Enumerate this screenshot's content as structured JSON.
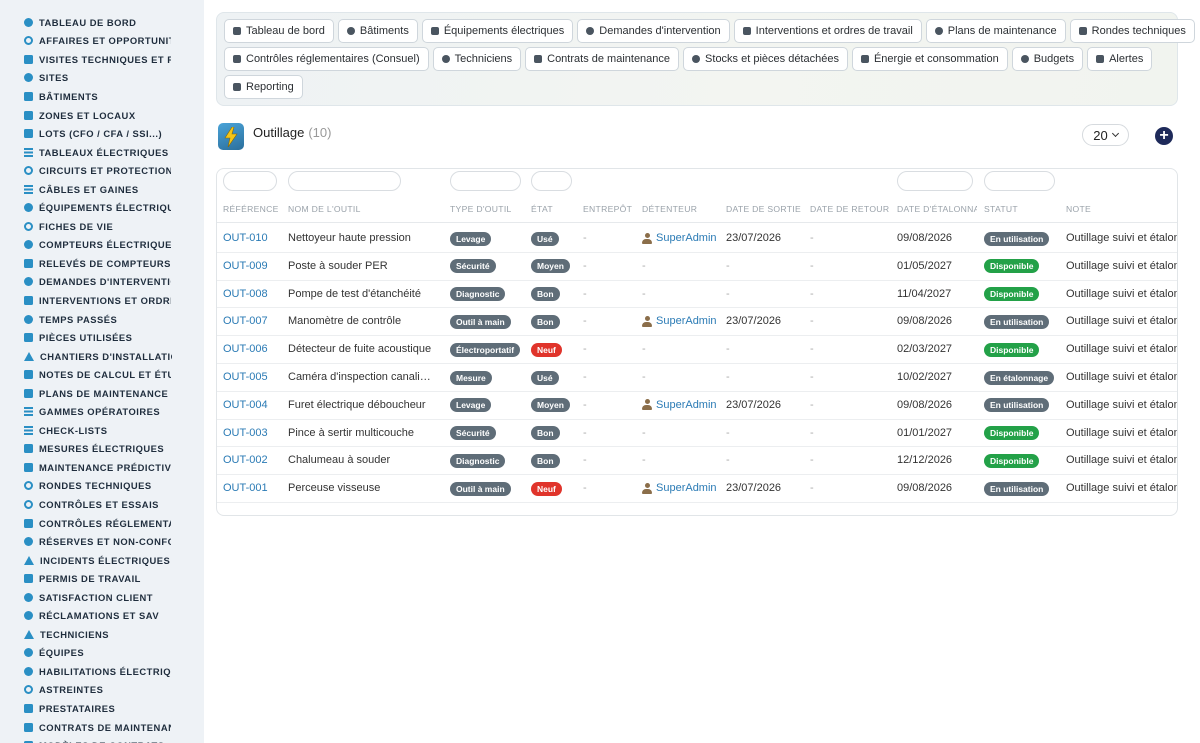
{
  "sidebar": {
    "items": [
      {
        "label": "TABLEAU DE BORD",
        "icon": "dashboard-icon",
        "shape": "circle"
      },
      {
        "label": "AFFAIRES ET OPPORTUNITÉS",
        "icon": "target-icon",
        "shape": "ring"
      },
      {
        "label": "VISITES TECHNIQUES ET RELEVÉS",
        "icon": "walk-icon",
        "shape": "square"
      },
      {
        "label": "SITES",
        "icon": "map-pin-icon",
        "shape": "circle"
      },
      {
        "label": "BÂTIMENTS",
        "icon": "building-icon",
        "shape": "square"
      },
      {
        "label": "ZONES ET LOCAUX",
        "icon": "door-icon",
        "shape": "square"
      },
      {
        "label": "LOTS (CFO / CFA / SSI...)",
        "icon": "sitemap-icon",
        "shape": "square"
      },
      {
        "label": "TABLEAUX ÉLECTRIQUES",
        "icon": "table-icon",
        "shape": "bars"
      },
      {
        "label": "CIRCUITS ET PROTECTIONS",
        "icon": "circuit-icon",
        "shape": "ring"
      },
      {
        "label": "CÂBLES ET GAINES",
        "icon": "cable-icon",
        "shape": "bars"
      },
      {
        "label": "ÉQUIPEMENTS ÉLECTRIQUES",
        "icon": "cogs-icon",
        "shape": "circle"
      },
      {
        "label": "FICHES DE VIE",
        "icon": "history-icon",
        "shape": "ring"
      },
      {
        "label": "COMPTEURS ÉLECTRIQUES",
        "icon": "gauge-icon",
        "shape": "circle"
      },
      {
        "label": "RELEVÉS DE COMPTEURS",
        "icon": "clipboard-icon",
        "shape": "square"
      },
      {
        "label": "DEMANDES D'INTERVENTION",
        "icon": "question-icon",
        "shape": "circle"
      },
      {
        "label": "INTERVENTIONS ET ORDRES DE TRAVAIL",
        "icon": "clipboard-check-icon",
        "shape": "square"
      },
      {
        "label": "TEMPS PASSÉS",
        "icon": "clock-icon",
        "shape": "circle"
      },
      {
        "label": "PIÈCES UTILISÉES",
        "icon": "cubes-icon",
        "shape": "square"
      },
      {
        "label": "CHANTIERS D'INSTALLATION",
        "icon": "hammer-icon",
        "shape": "tri"
      },
      {
        "label": "NOTES DE CALCUL ET ÉTUDES",
        "icon": "calculator-icon",
        "shape": "square"
      },
      {
        "label": "PLANS DE MAINTENANCE",
        "icon": "calendar-icon",
        "shape": "square"
      },
      {
        "label": "GAMMES OPÉRATOIRES",
        "icon": "list-icon",
        "shape": "bars"
      },
      {
        "label": "CHECK-LISTS",
        "icon": "checklist-icon",
        "shape": "bars"
      },
      {
        "label": "MESURES ÉLECTRIQUES",
        "icon": "ruler-icon",
        "shape": "square"
      },
      {
        "label": "MAINTENANCE PRÉDICTIVE",
        "icon": "chart-line-icon",
        "shape": "square"
      },
      {
        "label": "RONDES TECHNIQUES",
        "icon": "route-icon",
        "shape": "ring"
      },
      {
        "label": "CONTRÔLES ET ESSAIS",
        "icon": "search-icon",
        "shape": "ring"
      },
      {
        "label": "CONTRÔLES RÉGLEMENTAIRES (CONSUEL)",
        "icon": "clipboard-check-icon",
        "shape": "square"
      },
      {
        "label": "RÉSERVES ET NON-CONFORMITÉS",
        "icon": "exclamation-icon",
        "shape": "circle"
      },
      {
        "label": "INCIDENTS ÉLECTRIQUES",
        "icon": "warning-icon",
        "shape": "tri"
      },
      {
        "label": "PERMIS DE TRAVAIL",
        "icon": "file-signature-icon",
        "shape": "square"
      },
      {
        "label": "SATISFACTION CLIENT",
        "icon": "smile-icon",
        "shape": "circle"
      },
      {
        "label": "RÉCLAMATIONS ET SAV",
        "icon": "comment-icon",
        "shape": "circle"
      },
      {
        "label": "TECHNICIENS",
        "icon": "hard-hat-icon",
        "shape": "tri"
      },
      {
        "label": "ÉQUIPES",
        "icon": "users-icon",
        "shape": "circle"
      },
      {
        "label": "HABILITATIONS ÉLECTRIQUES",
        "icon": "certificate-icon",
        "shape": "circle"
      },
      {
        "label": "ASTREINTES",
        "icon": "phone-icon",
        "shape": "ring"
      },
      {
        "label": "PRESTATAIRES",
        "icon": "handshake-icon",
        "shape": "square"
      },
      {
        "label": "CONTRATS DE MAINTENANCE",
        "icon": "file-contract-icon",
        "shape": "square"
      },
      {
        "label": "MODÈLES DE CONTRATS",
        "icon": "file-icon",
        "shape": "square"
      }
    ]
  },
  "topnav": {
    "rows": [
      [
        {
          "label": "Tableau de bord",
          "icon": "dashboard-icon"
        },
        {
          "label": "Bâtiments",
          "icon": "building-icon"
        },
        {
          "label": "Équipements électriques",
          "icon": "cogs-icon"
        },
        {
          "label": "Demandes d'intervention",
          "icon": "question-icon"
        },
        {
          "label": "Interventions et ordres de travail",
          "icon": "clipboard-check-icon"
        },
        {
          "label": "Plans de maintenance",
          "icon": "calendar-icon"
        },
        {
          "label": "Rondes techniques",
          "icon": "route-icon"
        }
      ],
      [
        {
          "label": "Contrôles réglementaires (Consuel)",
          "icon": "clipboard-check-icon"
        },
        {
          "label": "Techniciens",
          "icon": "hard-hat-icon"
        },
        {
          "label": "Contrats de maintenance",
          "icon": "file-contract-icon"
        },
        {
          "label": "Stocks et pièces détachées",
          "icon": "sitemap-icon"
        },
        {
          "label": "Énergie et consommation",
          "icon": "bolt-icon"
        },
        {
          "label": "Budgets",
          "icon": "money-icon"
        },
        {
          "label": "Alertes",
          "icon": "bell-icon"
        }
      ],
      [
        {
          "label": "Reporting",
          "icon": "chart-pie-icon"
        }
      ]
    ]
  },
  "page": {
    "icon": "bolt-app-icon",
    "title": "Outillage",
    "count": "(10)",
    "per_page": "20",
    "add_icon": "plus-circle-icon"
  },
  "table": {
    "columns": [
      "RÉFÉRENCE",
      "NOM DE L'OUTIL",
      "TYPE D'OUTIL",
      "ÉTAT",
      "ENTREPÔT",
      "DÉTENTEUR",
      "DATE DE SORTIE",
      "DATE DE RETOUR",
      "DATE D'ÉTALONNAGE",
      "STATUT",
      "NOTE"
    ],
    "rows": [
      {
        "ref": "OUT-010",
        "name": "Nettoyeur haute pression",
        "type": "Levage",
        "state": "Usé",
        "state_color": "gray",
        "warehouse": "-",
        "holder": "SuperAdmin",
        "out_date": "23/07/2026",
        "return_date": "-",
        "cal_date": "09/08/2026",
        "status": "En utilisation",
        "status_color": "gray",
        "note": "Outillage suivi et étalonné"
      },
      {
        "ref": "OUT-009",
        "name": "Poste à souder PER",
        "type": "Sécurité",
        "state": "Moyen",
        "state_color": "gray",
        "warehouse": "-",
        "holder": "-",
        "out_date": "-",
        "return_date": "-",
        "cal_date": "01/05/2027",
        "status": "Disponible",
        "status_color": "green",
        "note": "Outillage suivi et étalonné"
      },
      {
        "ref": "OUT-008",
        "name": "Pompe de test d'étanchéité",
        "type": "Diagnostic",
        "state": "Bon",
        "state_color": "gray",
        "warehouse": "-",
        "holder": "-",
        "out_date": "-",
        "return_date": "-",
        "cal_date": "11/04/2027",
        "status": "Disponible",
        "status_color": "green",
        "note": "Outillage suivi et étalonné"
      },
      {
        "ref": "OUT-007",
        "name": "Manomètre de contrôle",
        "type": "Outil à main",
        "state": "Bon",
        "state_color": "gray",
        "warehouse": "-",
        "holder": "SuperAdmin",
        "out_date": "23/07/2026",
        "return_date": "-",
        "cal_date": "09/08/2026",
        "status": "En utilisation",
        "status_color": "gray",
        "note": "Outillage suivi et étalonné"
      },
      {
        "ref": "OUT-006",
        "name": "Détecteur de fuite acoustique",
        "type": "Électroportatif",
        "state": "Neuf",
        "state_color": "red",
        "warehouse": "-",
        "holder": "-",
        "out_date": "-",
        "return_date": "-",
        "cal_date": "02/03/2027",
        "status": "Disponible",
        "status_color": "green",
        "note": "Outillage suivi et étalonné"
      },
      {
        "ref": "OUT-005",
        "name": "Caméra d'inspection canalisation",
        "type": "Mesure",
        "state": "Usé",
        "state_color": "gray",
        "warehouse": "-",
        "holder": "-",
        "out_date": "-",
        "return_date": "-",
        "cal_date": "10/02/2027",
        "status": "En étalonnage",
        "status_color": "gray",
        "note": "Outillage suivi et étalonné"
      },
      {
        "ref": "OUT-004",
        "name": "Furet électrique déboucheur",
        "type": "Levage",
        "state": "Moyen",
        "state_color": "gray",
        "warehouse": "-",
        "holder": "SuperAdmin",
        "out_date": "23/07/2026",
        "return_date": "-",
        "cal_date": "09/08/2026",
        "status": "En utilisation",
        "status_color": "gray",
        "note": "Outillage suivi et étalonné"
      },
      {
        "ref": "OUT-003",
        "name": "Pince à sertir multicouche",
        "type": "Sécurité",
        "state": "Bon",
        "state_color": "gray",
        "warehouse": "-",
        "holder": "-",
        "out_date": "-",
        "return_date": "-",
        "cal_date": "01/01/2027",
        "status": "Disponible",
        "status_color": "green",
        "note": "Outillage suivi et étalonné"
      },
      {
        "ref": "OUT-002",
        "name": "Chalumeau à souder",
        "type": "Diagnostic",
        "state": "Bon",
        "state_color": "gray",
        "warehouse": "-",
        "holder": "-",
        "out_date": "-",
        "return_date": "-",
        "cal_date": "12/12/2026",
        "status": "Disponible",
        "status_color": "green",
        "note": "Outillage suivi et étalonné"
      },
      {
        "ref": "OUT-001",
        "name": "Perceuse visseuse",
        "type": "Outil à main",
        "state": "Neuf",
        "state_color": "red",
        "warehouse": "-",
        "holder": "SuperAdmin",
        "out_date": "23/07/2026",
        "return_date": "-",
        "cal_date": "09/08/2026",
        "status": "En utilisation",
        "status_color": "gray",
        "note": "Outillage suivi et étalonné"
      }
    ]
  },
  "colors": {
    "accent": "#2a8fc4",
    "link": "#2b7bb5",
    "badge_gray": "#5f6d78",
    "badge_green": "#23a148",
    "badge_red": "#e0342b",
    "add_button": "#1e2a5a"
  }
}
